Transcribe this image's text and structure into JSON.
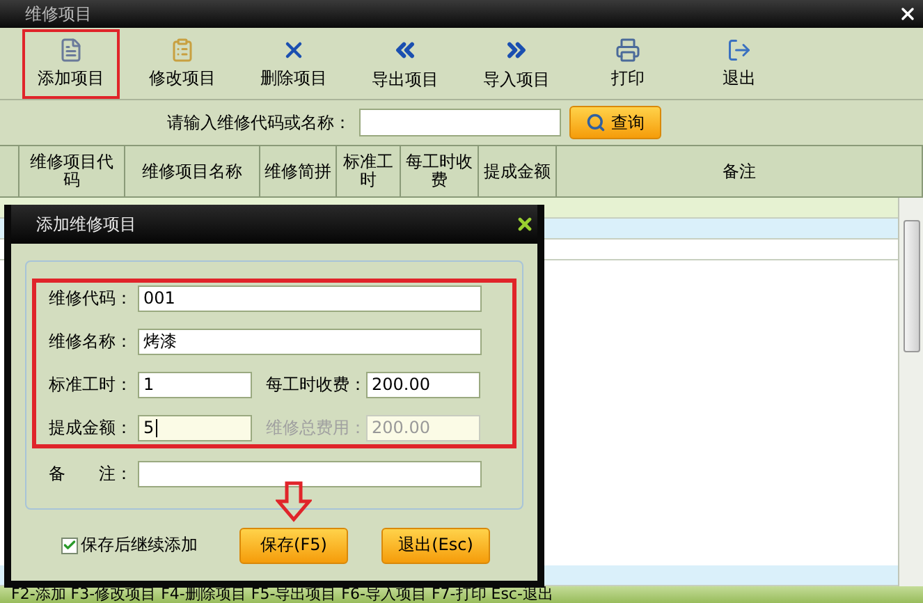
{
  "window": {
    "title": "维修项目"
  },
  "toolbar": [
    {
      "kind": "add",
      "label": "添加项目",
      "highlighted": true
    },
    {
      "kind": "edit",
      "label": "修改项目",
      "highlighted": false
    },
    {
      "kind": "delete",
      "label": "删除项目",
      "highlighted": false
    },
    {
      "kind": "export",
      "label": "导出项目",
      "highlighted": false
    },
    {
      "kind": "import",
      "label": "导入项目",
      "highlighted": false
    },
    {
      "kind": "print",
      "label": "打印",
      "highlighted": false
    },
    {
      "kind": "exit",
      "label": "退出",
      "highlighted": false
    }
  ],
  "search": {
    "label": "请输入维修代码或名称：",
    "button": "查询"
  },
  "table": {
    "columns": [
      "维修项目代码",
      "维修项目名称",
      "维修简拼",
      "标准工时",
      "每工时收费",
      "提成金额",
      "备注"
    ]
  },
  "dialog": {
    "title": "添加维修项目",
    "groups": [
      {
        "highlighted": true,
        "rows": [
          [
            {
              "label": "维修代码：",
              "value": "001",
              "disabled": false,
              "focused": false
            }
          ],
          [
            {
              "label": "维修名称：",
              "value": "烤漆",
              "disabled": false,
              "focused": false
            }
          ],
          [
            {
              "label": "标准工时：",
              "value": "1",
              "disabled": false,
              "focused": false
            },
            {
              "label": "每工时收费：",
              "value": "200.00",
              "disabled": false,
              "focused": false
            }
          ],
          [
            {
              "label": "提成金额：",
              "value": "5",
              "disabled": false,
              "focused": true
            },
            {
              "label": "维修总费用：",
              "value": "200.00",
              "disabled": true,
              "focused": false
            }
          ]
        ]
      },
      {
        "highlighted": false,
        "rows": [
          [
            {
              "label": "备　　注：",
              "disabled": false,
              "focused": false
            }
          ]
        ]
      }
    ],
    "checkbox": {
      "label": "保存后继续添加",
      "checked": true
    },
    "buttons": [
      {
        "label": "保存(F5)",
        "pointed": true
      },
      {
        "label": "退出(Esc)",
        "pointed": false
      }
    ]
  },
  "status_bar": "F2-添加 F3-修改项目 F4-删除项目 F5-导出项目 F6-导入项目 F7-打印 Esc-退出"
}
